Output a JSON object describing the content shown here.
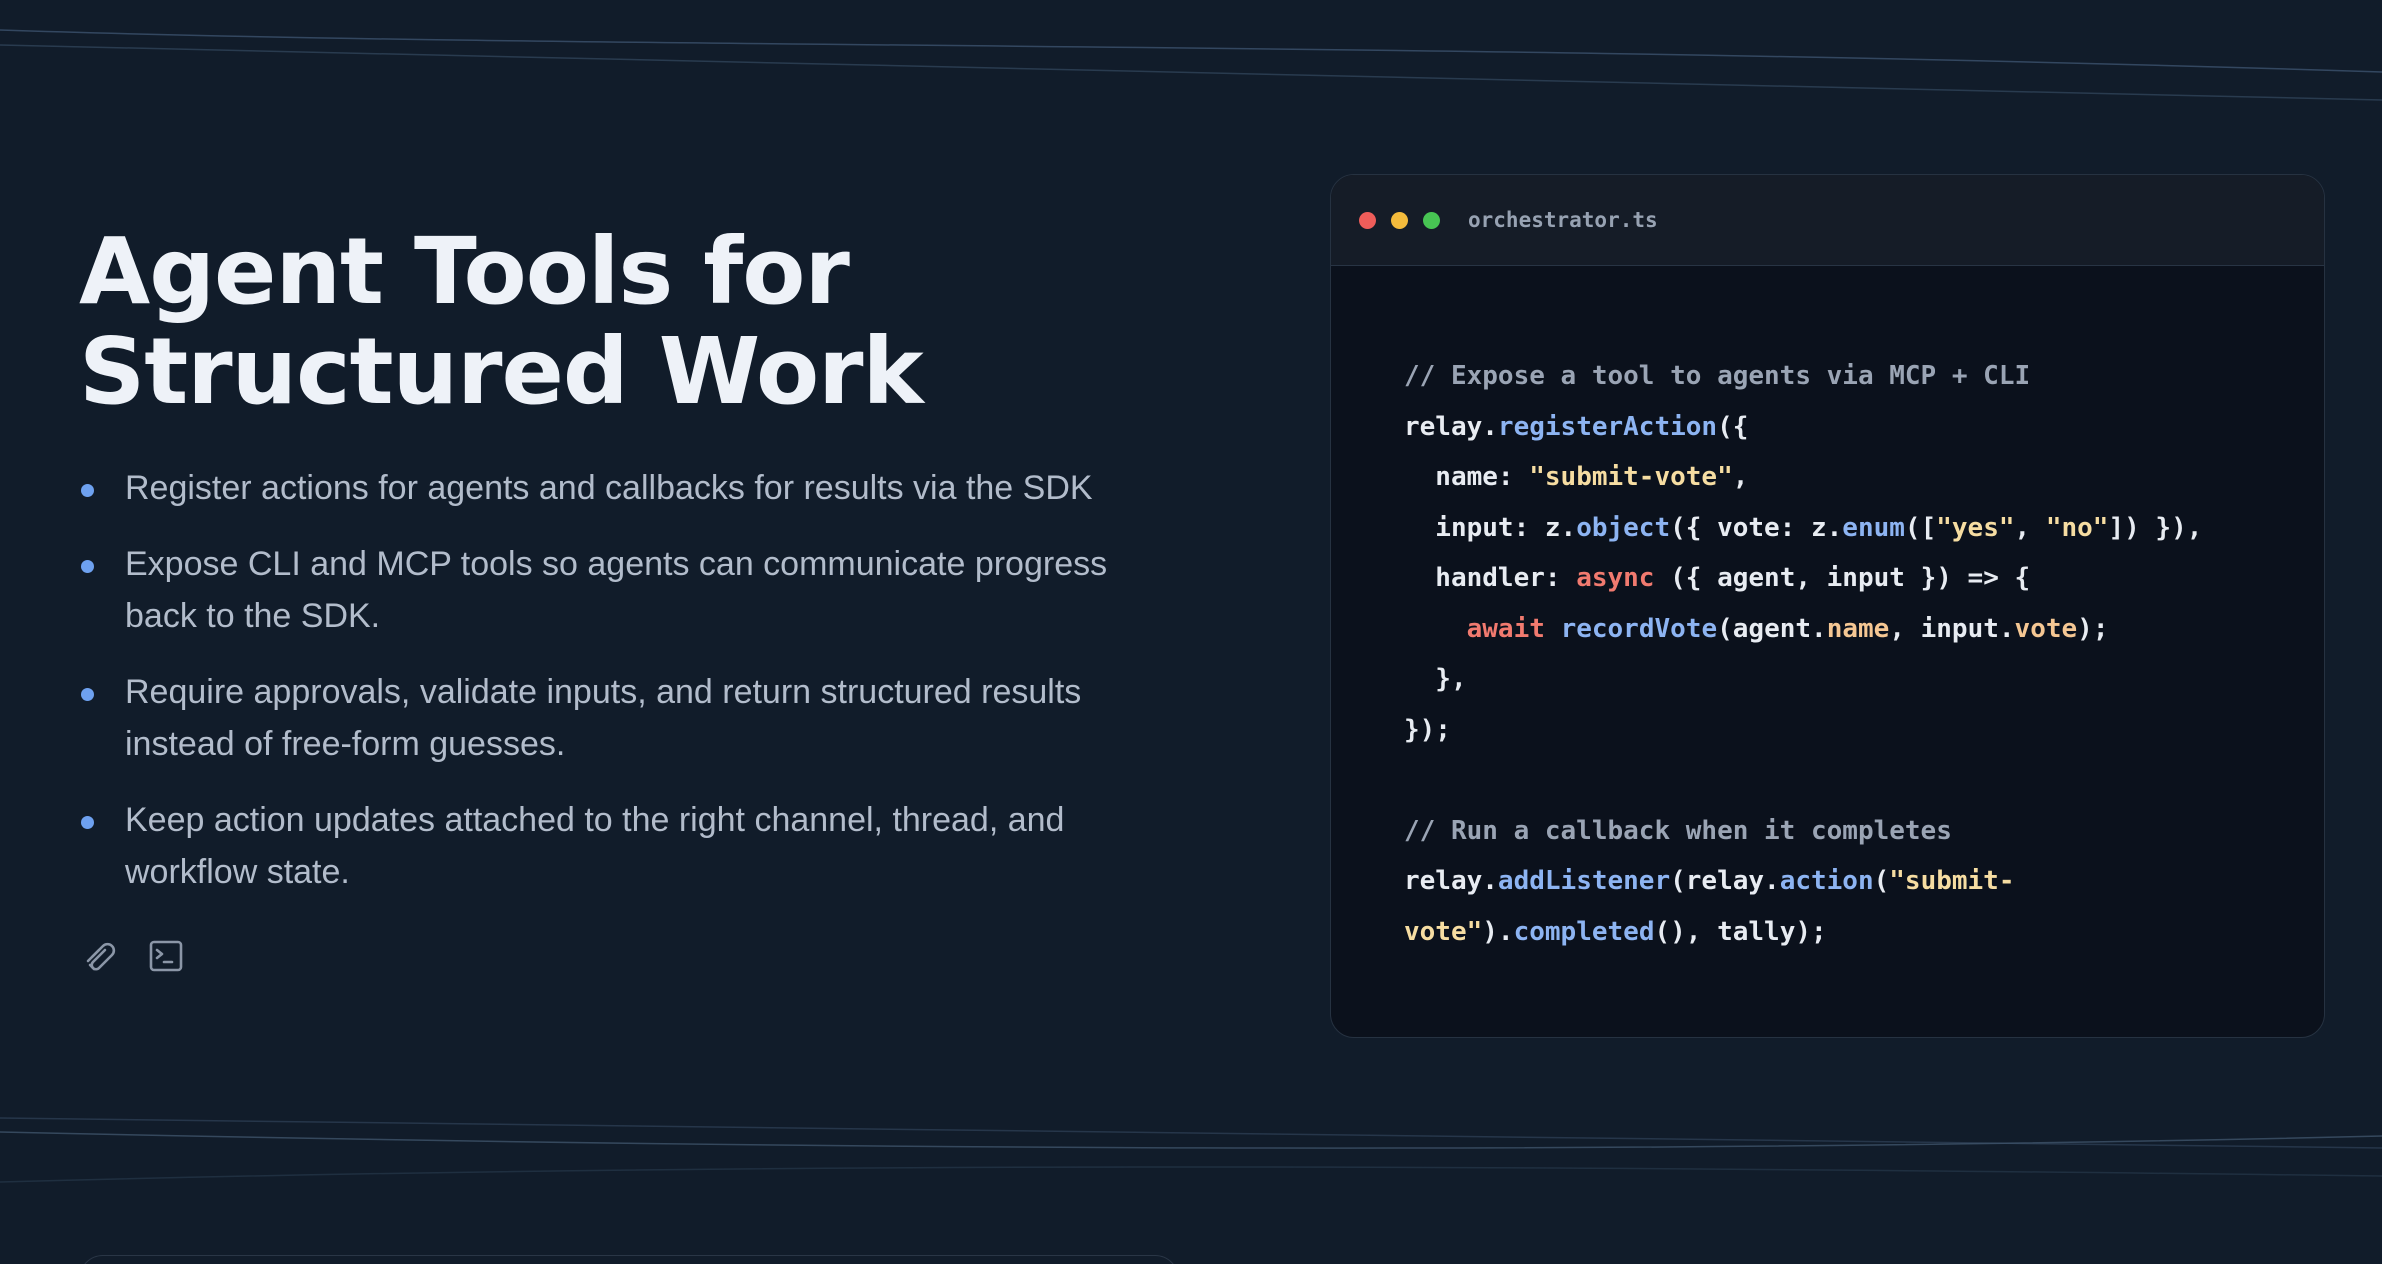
{
  "hero": {
    "title_line1": "Agent Tools for",
    "title_line2": "Structured Work"
  },
  "features": [
    {
      "text": "Register actions for agents and callbacks for results via the SDK"
    },
    {
      "text": "Expose CLI and MCP tools so agents can communicate progress back to the SDK."
    },
    {
      "text": "Require approvals, validate inputs, and return structured results instead of free-form guesses."
    },
    {
      "text": "Keep action updates attached to the right channel, thread, and workflow state."
    }
  ],
  "icons": [
    "paperclip-icon",
    "terminal-icon"
  ],
  "code_window": {
    "filename": "orchestrator.ts",
    "traffic_lights": {
      "close": "#ee5d5a",
      "minimize": "#f4bb3c",
      "maximize": "#47c453"
    },
    "lines": [
      [
        {
          "t": "// Expose a tool to agents via MCP + CLI",
          "k": "comment"
        }
      ],
      [
        {
          "t": "relay.",
          "k": "plain"
        },
        {
          "t": "registerAction",
          "k": "fn"
        },
        {
          "t": "({",
          "k": "plain"
        }
      ],
      [
        {
          "t": "  name: ",
          "k": "plain"
        },
        {
          "t": "\"submit-vote\"",
          "k": "string"
        },
        {
          "t": ",",
          "k": "plain"
        }
      ],
      [
        {
          "t": "  input: z.",
          "k": "plain"
        },
        {
          "t": "object",
          "k": "fn"
        },
        {
          "t": "({ vote: z.",
          "k": "plain"
        },
        {
          "t": "enum",
          "k": "fn"
        },
        {
          "t": "([",
          "k": "plain"
        },
        {
          "t": "\"yes\"",
          "k": "string"
        },
        {
          "t": ", ",
          "k": "plain"
        },
        {
          "t": "\"no\"",
          "k": "string"
        },
        {
          "t": "]) }),",
          "k": "plain"
        }
      ],
      [
        {
          "t": "  handler: ",
          "k": "plain"
        },
        {
          "t": "async",
          "k": "keyword"
        },
        {
          "t": " ({ agent, input }) => {",
          "k": "plain"
        }
      ],
      [
        {
          "t": "    ",
          "k": "plain"
        },
        {
          "t": "await",
          "k": "keyword"
        },
        {
          "t": " ",
          "k": "plain"
        },
        {
          "t": "recordVote",
          "k": "fn"
        },
        {
          "t": "(agent.",
          "k": "plain"
        },
        {
          "t": "name",
          "k": "prop"
        },
        {
          "t": ", input.",
          "k": "plain"
        },
        {
          "t": "vote",
          "k": "prop"
        },
        {
          "t": ");",
          "k": "plain"
        }
      ],
      [
        {
          "t": "  },",
          "k": "plain"
        }
      ],
      [
        {
          "t": "});",
          "k": "plain"
        }
      ],
      [],
      [
        {
          "t": "// Run a callback when it completes",
          "k": "comment"
        }
      ],
      [
        {
          "t": "relay.",
          "k": "plain"
        },
        {
          "t": "addListener",
          "k": "fn"
        },
        {
          "t": "(relay.",
          "k": "plain"
        },
        {
          "t": "action",
          "k": "fn"
        },
        {
          "t": "(",
          "k": "plain"
        },
        {
          "t": "\"submit-",
          "k": "string"
        }
      ],
      [
        {
          "t": "vote\"",
          "k": "string"
        },
        {
          "t": ").",
          "k": "plain"
        },
        {
          "t": "completed",
          "k": "fn"
        },
        {
          "t": "(), tally);",
          "k": "plain"
        }
      ]
    ]
  },
  "colors": {
    "background": "#111c2a",
    "accent_bullet": "#6ea1f0",
    "title": "#eef2f8",
    "body_text": "#b2bccb"
  }
}
